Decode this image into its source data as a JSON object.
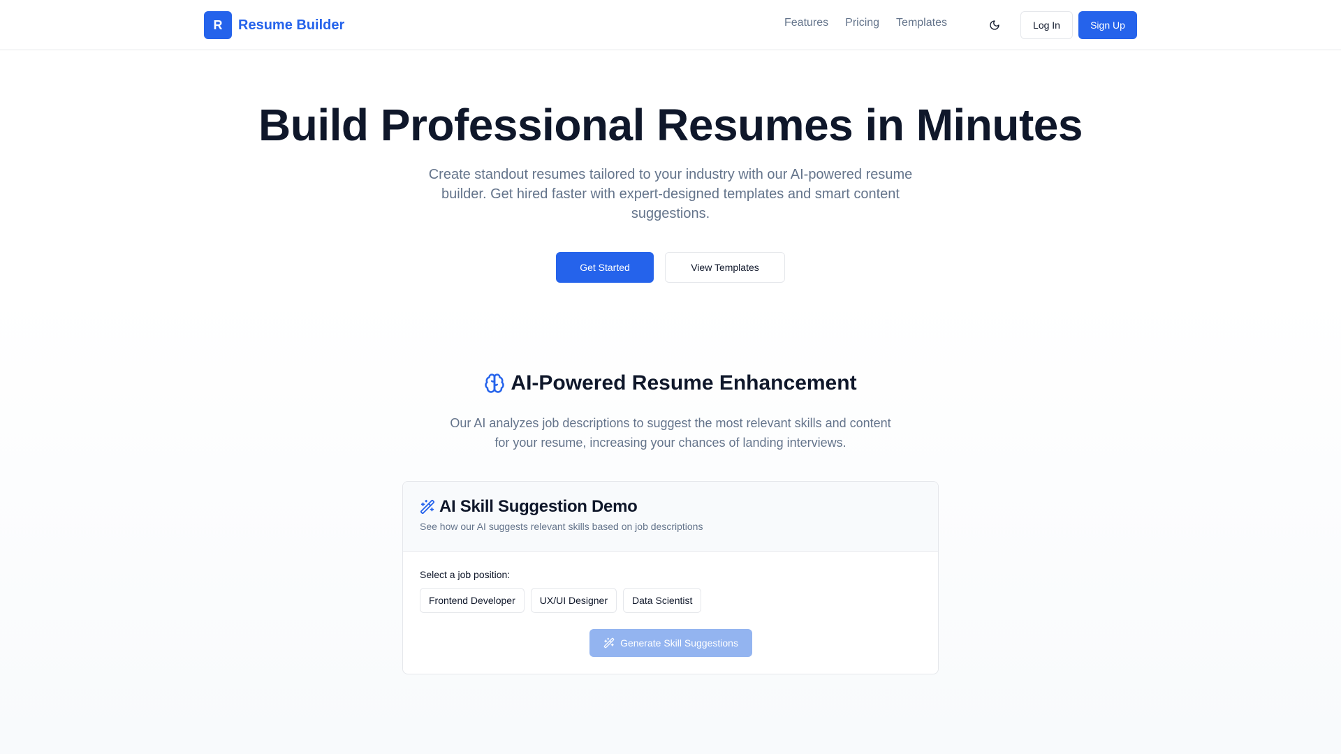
{
  "brand": {
    "mark": "R",
    "name": "Resume Builder"
  },
  "nav": {
    "items": [
      "Features",
      "Pricing",
      "Templates"
    ]
  },
  "header": {
    "login_label": "Log In",
    "signup_label": "Sign Up"
  },
  "hero": {
    "title": "Build Professional Resumes in Minutes",
    "subtitle": "Create standout resumes tailored to your industry with our AI-powered resume builder. Get hired faster with expert-designed templates and smart content suggestions.",
    "primary_cta": "Get Started",
    "secondary_cta": "View Templates"
  },
  "ai_section": {
    "title": "AI-Powered Resume Enhancement",
    "subtitle": "Our AI analyzes job descriptions to suggest the most relevant skills and content for your resume, increasing your chances of landing interviews."
  },
  "demo": {
    "title": "AI Skill Suggestion Demo",
    "description": "See how our AI suggests relevant skills based on job descriptions",
    "select_label": "Select a job position:",
    "positions": [
      "Frontend Developer",
      "UX/UI Designer",
      "Data Scientist"
    ],
    "generate_label": "Generate Skill Suggestions"
  },
  "icons": {
    "theme_toggle": "moon-icon",
    "ai_heading": "brain-icon",
    "demo_title": "magic-wand-icon",
    "generate": "magic-wand-icon"
  },
  "colors": {
    "accent": "#2563eb",
    "text_primary": "#0f172a",
    "text_muted": "#64748b",
    "border": "#e5e7eb",
    "disabled_button": "#93b4f0"
  }
}
